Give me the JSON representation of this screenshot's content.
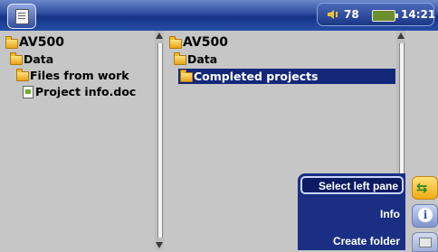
{
  "status": {
    "volume_icon": "speaker-icon",
    "volume": "78",
    "battery_icon": "battery-icon",
    "time": "14:21"
  },
  "left_pane": {
    "root": "AV500",
    "items": [
      {
        "type": "folder",
        "label": "Data"
      },
      {
        "type": "folder",
        "label": "Files from work"
      },
      {
        "type": "file",
        "label": "Project info.doc"
      }
    ]
  },
  "right_pane": {
    "root": "AV500",
    "items": [
      {
        "type": "folder",
        "label": "Data"
      },
      {
        "type": "folder",
        "label": "Completed projects",
        "selected": true
      }
    ]
  },
  "menu": {
    "items": [
      {
        "label": "Select left pane",
        "icon": "swap-pane-icon",
        "selected": true
      },
      {
        "label": "Info",
        "icon": "info-icon"
      },
      {
        "label": "Create folder",
        "icon": "new-folder-icon"
      }
    ]
  },
  "colors": {
    "topbar": "#1f3f93",
    "selection": "#14287a",
    "pane_bg": "#c6c6c6"
  }
}
